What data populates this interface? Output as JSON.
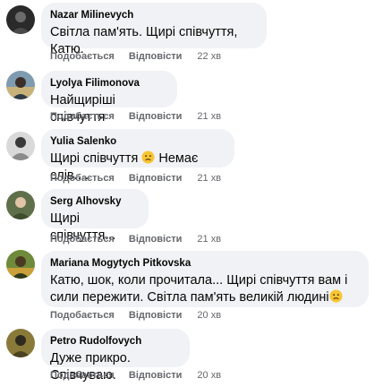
{
  "comments": [
    {
      "author": "Nazar Milinevych",
      "text": "Світла пам'ять. Щирі співчуття, Катю.",
      "emoji_after": false,
      "like": "Подобається",
      "reply": "Відповісти",
      "time": "22 хв"
    },
    {
      "author": "Lyolya Filimonova",
      "text": "Найщиріші співчуття",
      "emoji_after": false,
      "like": "Подобається",
      "reply": "Відповісти",
      "time": "21 хв"
    },
    {
      "author": "Yulia Salenko",
      "text_before": "Щирі співчуття",
      "text_after": " Немає слів....",
      "like": "Подобається",
      "reply": "Відповісти",
      "time": "21 хв"
    },
    {
      "author": "Serg Alhovsky",
      "text": "Щирі співчуття...",
      "like": "Подобається",
      "reply": "Відповісти",
      "time": "21 хв"
    },
    {
      "author": "Mariana Mogytych Pitkovska",
      "text": "Катю, шок, коли прочитала... Щирі співчуття вам і сили пережити. Світла пам'ять великій людині",
      "like": "Подобається",
      "reply": "Відповісти",
      "time": "20 хв"
    },
    {
      "author": "Petro Rudolfovych",
      "text": "Дуже прикро. Співчуваю.",
      "like": "Подобається",
      "reply": "Відповісти",
      "time": "20 хв"
    }
  ],
  "icons": {
    "sad_emoji": "sad-face-icon"
  }
}
